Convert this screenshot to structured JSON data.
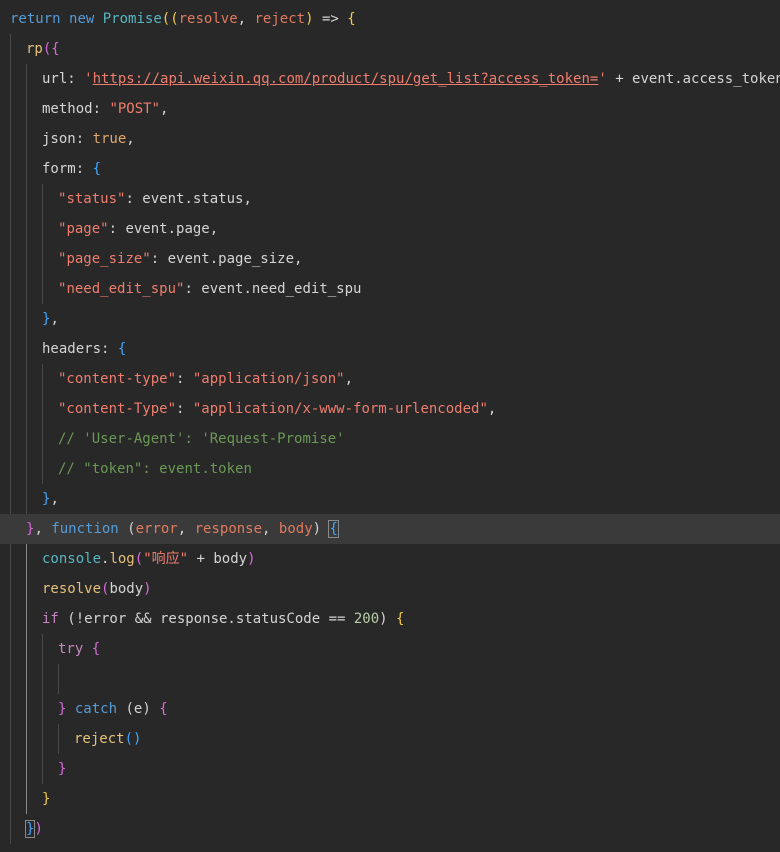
{
  "editor": {
    "lines": [
      {
        "tokens": [
          [
            "return",
            "kw"
          ],
          [
            " ",
            "punc"
          ],
          [
            "new",
            "kw"
          ],
          [
            " ",
            "punc"
          ],
          [
            "Promise",
            "cls"
          ],
          [
            "((",
            "br1"
          ],
          [
            "resolve",
            "par"
          ],
          [
            ", ",
            "punc"
          ],
          [
            "reject",
            "par"
          ],
          [
            ")",
            "br1"
          ],
          [
            " => ",
            "punc"
          ],
          [
            "{",
            "br1"
          ]
        ]
      },
      {
        "tokens": [
          [
            "rp",
            "fn"
          ],
          [
            "({",
            "br2"
          ]
        ]
      },
      {
        "tokens": [
          [
            "url",
            "prop"
          ],
          [
            ": ",
            "punc"
          ],
          [
            "'",
            "str"
          ],
          [
            "https://api.weixin.qq.com/product/spu/get_list?access_token=",
            "url"
          ],
          [
            "'",
            "str"
          ],
          [
            " + event.access_token,",
            "punc"
          ]
        ]
      },
      {
        "tokens": [
          [
            "method",
            "prop"
          ],
          [
            ": ",
            "punc"
          ],
          [
            "\"POST\"",
            "str"
          ],
          [
            ",",
            "punc"
          ]
        ]
      },
      {
        "tokens": [
          [
            "json",
            "prop"
          ],
          [
            ": ",
            "punc"
          ],
          [
            "true",
            "bool"
          ],
          [
            ",",
            "punc"
          ]
        ]
      },
      {
        "tokens": [
          [
            "form",
            "prop"
          ],
          [
            ": ",
            "punc"
          ],
          [
            "{",
            "br3"
          ]
        ]
      },
      {
        "tokens": [
          [
            "\"",
            "str"
          ],
          [
            "status",
            "str"
          ],
          [
            "\"",
            "str"
          ],
          [
            ": event.status,",
            "punc"
          ]
        ]
      },
      {
        "tokens": [
          [
            "\"",
            "str"
          ],
          [
            "page",
            "str"
          ],
          [
            "\"",
            "str"
          ],
          [
            ": event.page,",
            "punc"
          ]
        ]
      },
      {
        "tokens": [
          [
            "\"",
            "str"
          ],
          [
            "page_size",
            "str"
          ],
          [
            "\"",
            "str"
          ],
          [
            ": event.page_size,",
            "punc"
          ]
        ]
      },
      {
        "tokens": [
          [
            "\"",
            "str"
          ],
          [
            "need_edit_spu",
            "str"
          ],
          [
            "\"",
            "str"
          ],
          [
            ": event.need_edit_spu",
            "punc"
          ]
        ]
      },
      {
        "tokens": [
          [
            "}",
            "br3"
          ],
          [
            ",",
            "punc"
          ]
        ]
      },
      {
        "tokens": [
          [
            "headers",
            "prop"
          ],
          [
            ": ",
            "punc"
          ],
          [
            "{",
            "br3"
          ]
        ]
      },
      {
        "tokens": [
          [
            "\"content-type\"",
            "str"
          ],
          [
            ": ",
            "punc"
          ],
          [
            "\"application/json\"",
            "str"
          ],
          [
            ",",
            "punc"
          ]
        ]
      },
      {
        "tokens": [
          [
            "\"content-Type\"",
            "str"
          ],
          [
            ": ",
            "punc"
          ],
          [
            "\"application/x-www-form-urlencoded\"",
            "str"
          ],
          [
            ",",
            "punc"
          ]
        ]
      },
      {
        "tokens": [
          [
            "// ",
            "cmt"
          ],
          [
            "'User-Agent'",
            "cmt"
          ],
          [
            ": ",
            "cmt"
          ],
          [
            "'Request-Promise'",
            "cmt"
          ]
        ]
      },
      {
        "tokens": [
          [
            "// ",
            "cmt"
          ],
          [
            "\"token\"",
            "cmt"
          ],
          [
            ": event.token",
            "cmt"
          ]
        ]
      },
      {
        "tokens": [
          [
            "}",
            "br3"
          ],
          [
            ",",
            "punc"
          ]
        ]
      },
      {
        "tokens": [
          [
            "}",
            "br2"
          ],
          [
            ", ",
            "punc"
          ],
          [
            "function",
            "kw"
          ],
          [
            " (",
            "punc"
          ],
          [
            "error",
            "par"
          ],
          [
            ", ",
            "punc"
          ],
          [
            "response",
            "par"
          ],
          [
            ", ",
            "punc"
          ],
          [
            "body",
            "par"
          ],
          [
            ") ",
            "punc"
          ],
          [
            "{",
            "br3"
          ]
        ]
      },
      {
        "tokens": [
          [
            "console",
            "cls"
          ],
          [
            ".",
            "punc"
          ],
          [
            "log",
            "fn"
          ],
          [
            "(",
            "br2"
          ],
          [
            "\"响应\"",
            "str"
          ],
          [
            " + body",
            "punc"
          ],
          [
            ")",
            "br2"
          ]
        ]
      },
      {
        "tokens": [
          [
            "resolve",
            "fn"
          ],
          [
            "(",
            "br2"
          ],
          [
            "body",
            "punc"
          ],
          [
            ")",
            "br2"
          ]
        ]
      },
      {
        "tokens": [
          [
            "if",
            "kw2"
          ],
          [
            " (",
            "punc"
          ],
          [
            "!error && response.statusCode == ",
            "punc"
          ],
          [
            "200",
            "num"
          ],
          [
            ") ",
            "punc"
          ],
          [
            "{",
            "br1"
          ]
        ]
      },
      {
        "tokens": [
          [
            "try",
            "kw2"
          ],
          [
            " ",
            "punc"
          ],
          [
            "{",
            "br2"
          ]
        ]
      },
      {
        "tokens": []
      },
      {
        "tokens": [
          [
            "}",
            "br2"
          ],
          [
            " ",
            "punc"
          ],
          [
            "catch",
            "kw"
          ],
          [
            " (e) ",
            "punc"
          ],
          [
            "{",
            "br2"
          ]
        ]
      },
      {
        "tokens": [
          [
            "reject",
            "fn"
          ],
          [
            "()",
            "br3"
          ]
        ]
      },
      {
        "tokens": [
          [
            "}",
            "br2"
          ]
        ]
      },
      {
        "tokens": [
          [
            "}",
            "br1"
          ]
        ]
      },
      {
        "tokens": [
          [
            "}",
            "br3"
          ],
          [
            ")",
            "br2"
          ]
        ]
      }
    ]
  }
}
